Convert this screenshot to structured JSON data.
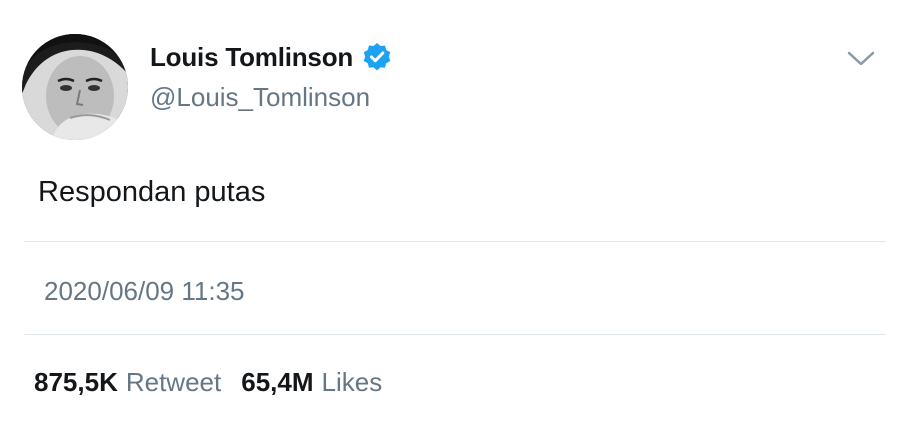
{
  "user": {
    "display_name": "Louis Tomlinson",
    "handle": "@Louis_Tomlinson",
    "verified": true
  },
  "tweet": {
    "text": "Respondan putas",
    "timestamp": "2020/06/09 11:35"
  },
  "stats": {
    "retweets_count": "875,5K",
    "retweets_label": "Retweet",
    "likes_count": "65,4M",
    "likes_label": "Likes"
  },
  "icons": {
    "verified": "verified-badge-icon",
    "menu": "chevron-down-icon"
  },
  "colors": {
    "verified_blue": "#1da1f2",
    "secondary_text": "#657786",
    "primary_text": "#14171a",
    "divider": "#e1e8ed"
  }
}
